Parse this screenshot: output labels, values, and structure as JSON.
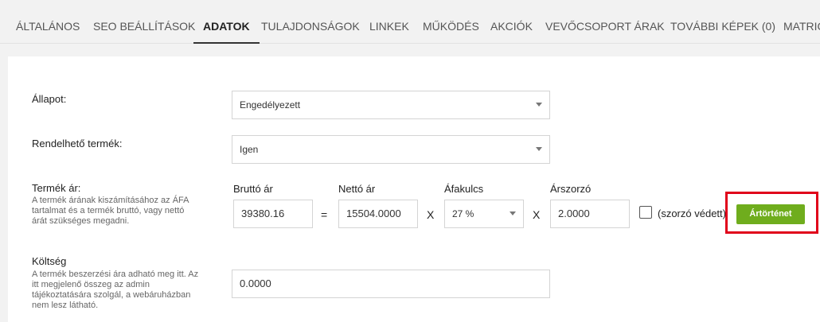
{
  "tabs": [
    {
      "label": "ÁLTALÁNOS"
    },
    {
      "label": "SEO BEÁLLÍTÁSOK"
    },
    {
      "label": "ADATOK"
    },
    {
      "label": "TULAJDONSÁGOK"
    },
    {
      "label": "LINKEK"
    },
    {
      "label": "MŰKÖDÉS"
    },
    {
      "label": "AKCIÓK"
    },
    {
      "label": "VEVŐCSOPORT ÁRAK"
    },
    {
      "label": "TOVÁBBI KÉPEK (0)"
    },
    {
      "label": "MATRIC"
    }
  ],
  "active_tab": "ADATOK",
  "status": {
    "label": "Állapot:",
    "value": "Engedélyezett"
  },
  "orderable": {
    "label": "Rendelhető termék:",
    "value": "Igen"
  },
  "price": {
    "label": "Termék ár:",
    "help": [
      "A termék árának kiszámításához az ÁFA",
      "tartalmat és a termék bruttó, vagy nettó",
      "árát szükséges megadni."
    ],
    "gross_label": "Bruttó ár",
    "gross_value": "39380.16",
    "equals": "=",
    "net_label": "Nettó ár",
    "net_value": "15504.0000",
    "times1": "X",
    "vat_label": "Áfakulcs",
    "vat_value": "27 %",
    "times2": "X",
    "multiplier_label": "Árszorzó",
    "multiplier_value": "2.0000",
    "protected_label": "(szorzó védett)",
    "protected_checked": false,
    "history_button": "Ártörténet"
  },
  "cost": {
    "label": "Költség",
    "help": [
      "A termék beszerzési ára adható meg itt. Az",
      "itt megjelenő összeg az admin",
      "tájékoztatására szolgál, a webáruházban",
      "nem lesz látható."
    ],
    "value": "0.0000"
  },
  "colors": {
    "accent_green": "#6fad1d",
    "highlight_red": "#e0001a"
  }
}
